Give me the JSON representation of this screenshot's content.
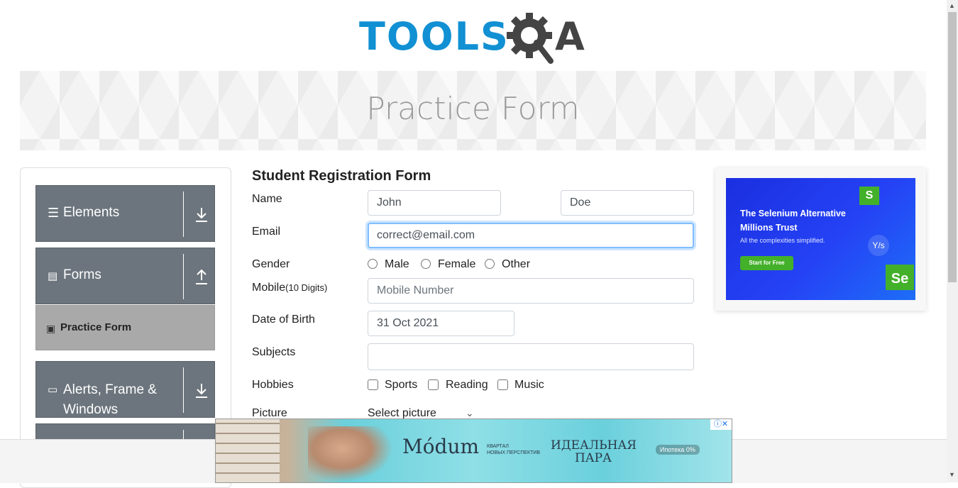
{
  "header": {
    "logo_text_tools": "TOOLS",
    "logo_text_a": "A"
  },
  "banner": {
    "title": "Practice Form"
  },
  "sidebar": {
    "groups": [
      {
        "label": "Elements",
        "icon": "hamburger-icon",
        "arrow": "download-icon"
      },
      {
        "label": "Forms",
        "icon": "document-icon",
        "arrow": "upload-icon"
      },
      {
        "label": "Alerts, Frame & Windows",
        "icon": "window-icon",
        "arrow": "download-icon"
      }
    ],
    "active_item": {
      "label": "Practice Form",
      "icon": "html5-icon"
    }
  },
  "form": {
    "title": "Student Registration Form",
    "name_label": "Name",
    "first_name_value": "John",
    "last_name_value": "Doe",
    "email_label": "Email",
    "email_value": "correct@email.com",
    "gender_label": "Gender",
    "gender_options": [
      "Male",
      "Female",
      "Other"
    ],
    "mobile_label": "Mobile",
    "mobile_hint": "(10 Digits)",
    "mobile_placeholder": "Mobile Number",
    "dob_label": "Date of Birth",
    "dob_value": "31 Oct 2021",
    "subjects_label": "Subjects",
    "subjects_value": "",
    "hobbies_label": "Hobbies",
    "hobbies_options": [
      "Sports",
      "Reading",
      "Music"
    ],
    "picture_label": "Picture",
    "picture_select": "Select picture"
  },
  "right_ad": {
    "headline": "The Selenium Alternative Millions Trust",
    "subtext": "All the complexities simplified.",
    "cta": "Start for Free",
    "badge_s": "S",
    "badge_se": "Se",
    "badge_ys": "Y/s",
    "accent": "#2542f5",
    "green": "#43b02a"
  },
  "bottom_ad": {
    "brand": "Módum",
    "brand_sub_line1": "КВАРТАЛ",
    "brand_sub_line2": "НОВЫХ ПЕРСПЕКТИВ",
    "pair_line1": "ИДЕАЛЬНАЯ",
    "pair_line2": "ПАРА",
    "mortgage": "Ипотека 0%",
    "close_icons": "ⓘ✕"
  },
  "colors": {
    "sidebar_bg": "#6c757d",
    "sidebar_active": "#a9a9a9",
    "logo_blue": "#1190d3",
    "focus_border": "#80bdff"
  }
}
